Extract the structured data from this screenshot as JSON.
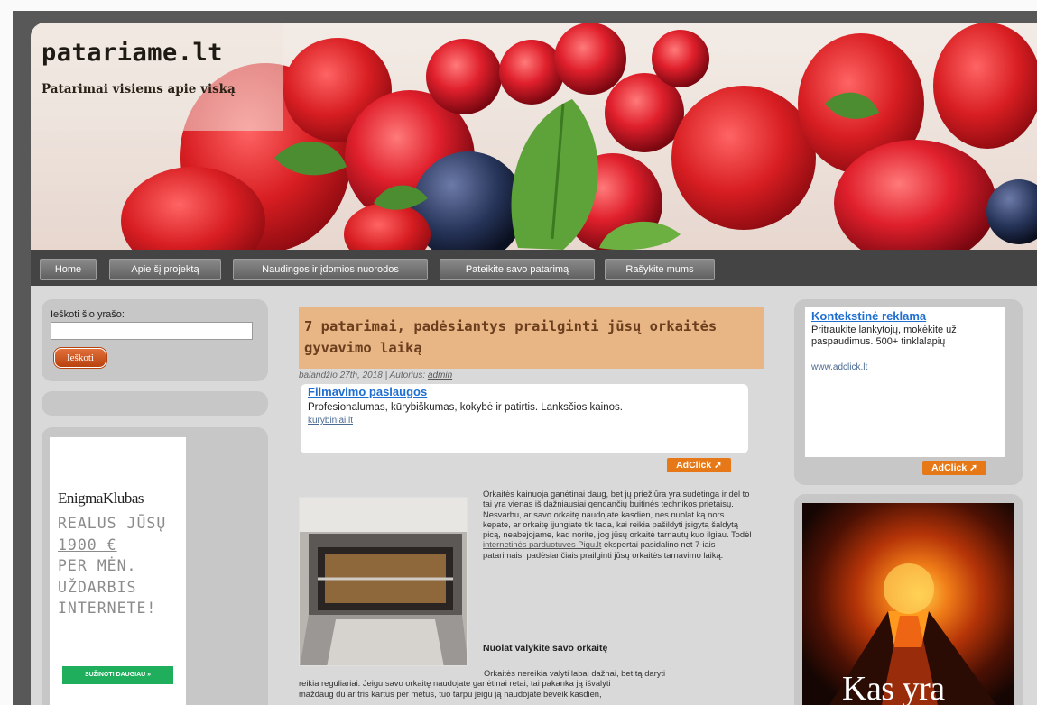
{
  "site": {
    "title": "patariame.lt",
    "tagline": "Patarimai visiems apie viską"
  },
  "nav": {
    "items": [
      {
        "label": "Home"
      },
      {
        "label": "Apie šį projektą"
      },
      {
        "label": "Naudingos ir įdomios nuorodos"
      },
      {
        "label": "Pateikite savo patarimą"
      },
      {
        "label": "Rašykite mums"
      }
    ]
  },
  "search": {
    "label": "Ieškoti šio yrašo:",
    "button": "Ieškoti",
    "value": ""
  },
  "left_ad": {
    "brand": "EnigmaKlubas",
    "line1": "REALUS JŪSŲ",
    "amount": "1900 €",
    "line3": "PER MĖN.",
    "line4": "UŽDARBIS",
    "line5": "INTERNETE!",
    "cta": "SUŽINOTI DAUGIAU »"
  },
  "post": {
    "title": "7 patarimai, padėsiantys prailginti jūsų orkaitės gyvavimo laiką",
    "meta_prefix": "balandžio 27th, 2018 | Autorius: ",
    "author": "admin",
    "inline_ad": {
      "title": "Filmavimo paslaugos",
      "desc": "Profesionalumas, kūrybiškumas, kokybė ir patirtis. Lanksčios kainos.",
      "link": "kurybiniai.lt",
      "adclick": "AdClick"
    },
    "body_before_link": "Orkaitės kainuoja ganėtinai daug, bet jų priežiūra yra sudėtinga ir dėl to tai yra vienas iš dažniausiai gendančių buitinės technikos prietaisų. Nesvarbu, ar savo orkaitę naudojate kasdien, nes nuolat ką nors kepate, ar orkaitę įjungiate tik tada, kai reikia pašildyti įsigytą šaldytą picą, neabejojame, kad norite, jog jūsų orkaitė tarnautų kuo ilgiau. Todėl ",
    "body_link": "internetinės parduotuvės Pigu.lt",
    "body_after_link": " ekspertai pasidalino net 7-iais patarimais, padėsiančiais prailginti jūsų orkaitės tarnavimo laiką.",
    "heading": "Nuolat valykite savo orkaitę",
    "p2_line1": "Orkaitės nereikia valyti labai dažnai, bet tą daryti",
    "p2_line2": "reikia reguliariai. Jeigu savo orkaitę naudojate ganėtinai retai, tai pakanka ją išvalyti",
    "p2_line3": "maždaug du ar tris kartus per metus, tuo tarpu jeigu ją naudojate beveik kasdien,"
  },
  "right_ad": {
    "title": "Kontekstinė reklama",
    "desc": "Pritraukite lankytojų, mokėkite už paspaudimus. 500+ tinklalapių",
    "link": "www.adclick.lt",
    "adclick": "AdClick"
  },
  "right_banner": {
    "text": "Kas yra"
  },
  "colors": {
    "frame": "#585858",
    "nav_bg": "#444444",
    "post_title_bg": "#e8b584",
    "accent_orange": "#e77817",
    "link_blue": "#1f6fd1"
  }
}
